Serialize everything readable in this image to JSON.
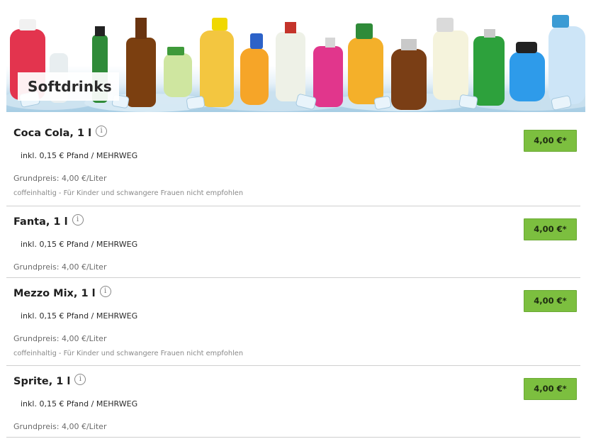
{
  "category": {
    "title": "Softdrinks"
  },
  "products": [
    {
      "name": "Coca Cola, 1 l",
      "deposit": "inkl. 0,15 € Pfand / MEHRWEG",
      "base_price": "Grundpreis: 4,00 €/Liter",
      "note": "coffeinhaltig - Für Kinder und schwangere Frauen nicht empfohlen",
      "price": "4,00 €*"
    },
    {
      "name": "Fanta, 1 l",
      "deposit": "inkl. 0,15 € Pfand / MEHRWEG",
      "base_price": "Grundpreis: 4,00 €/Liter",
      "price": "4,00 €*"
    },
    {
      "name": "Mezzo Mix, 1 l",
      "deposit": "inkl. 0,15 € Pfand / MEHRWEG",
      "base_price": "Grundpreis: 4,00 €/Liter",
      "note": "coffeinhaltig - Für Kinder und schwangere Frauen nicht empfohlen",
      "price": "4,00 €*"
    },
    {
      "name": "Sprite, 1 l",
      "deposit": "inkl. 0,15 € Pfand / MEHRWEG",
      "base_price": "Grundpreis: 4,00 €/Liter",
      "price": "4,00 €*"
    }
  ],
  "icons": {
    "info": "info-circle-icon"
  },
  "colors": {
    "price_button": "#7cbf3f",
    "divider": "#cfcfcf"
  }
}
